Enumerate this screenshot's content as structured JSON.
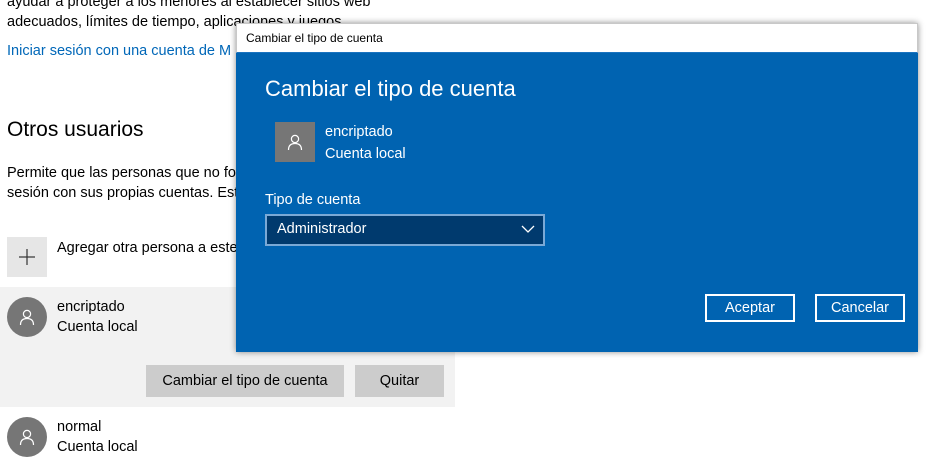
{
  "background": {
    "intro_line1": "ayudar a proteger a los menores al establecer sitios web",
    "intro_line2": "adecuados, límites de tiempo, aplicaciones y juegos.",
    "signin_link": "Iniciar sesión con una cuenta de M",
    "section_title": "Otros usuarios",
    "desc_line1": "Permite que las personas que no fo",
    "desc_line2": "sesión con sus propias cuentas. Est",
    "add_person_label": "Agregar otra persona a este",
    "users": [
      {
        "name": "encriptado",
        "type": "Cuenta local"
      },
      {
        "name": "normal",
        "type": "Cuenta local"
      }
    ],
    "change_type_button": "Cambiar el tipo de cuenta",
    "remove_button": "Quitar"
  },
  "dialog": {
    "window_title": "Cambiar el tipo de cuenta",
    "heading": "Cambiar el tipo de cuenta",
    "user_name": "encriptado",
    "user_type": "Cuenta local",
    "account_type_label": "Tipo de cuenta",
    "account_type_value": "Administrador",
    "ok_button": "Aceptar",
    "cancel_button": "Cancelar",
    "accent_color": "#0063b1"
  },
  "icons": {
    "add": "plus-icon",
    "avatar": "person-icon",
    "dropdown": "chevron-down-icon"
  }
}
